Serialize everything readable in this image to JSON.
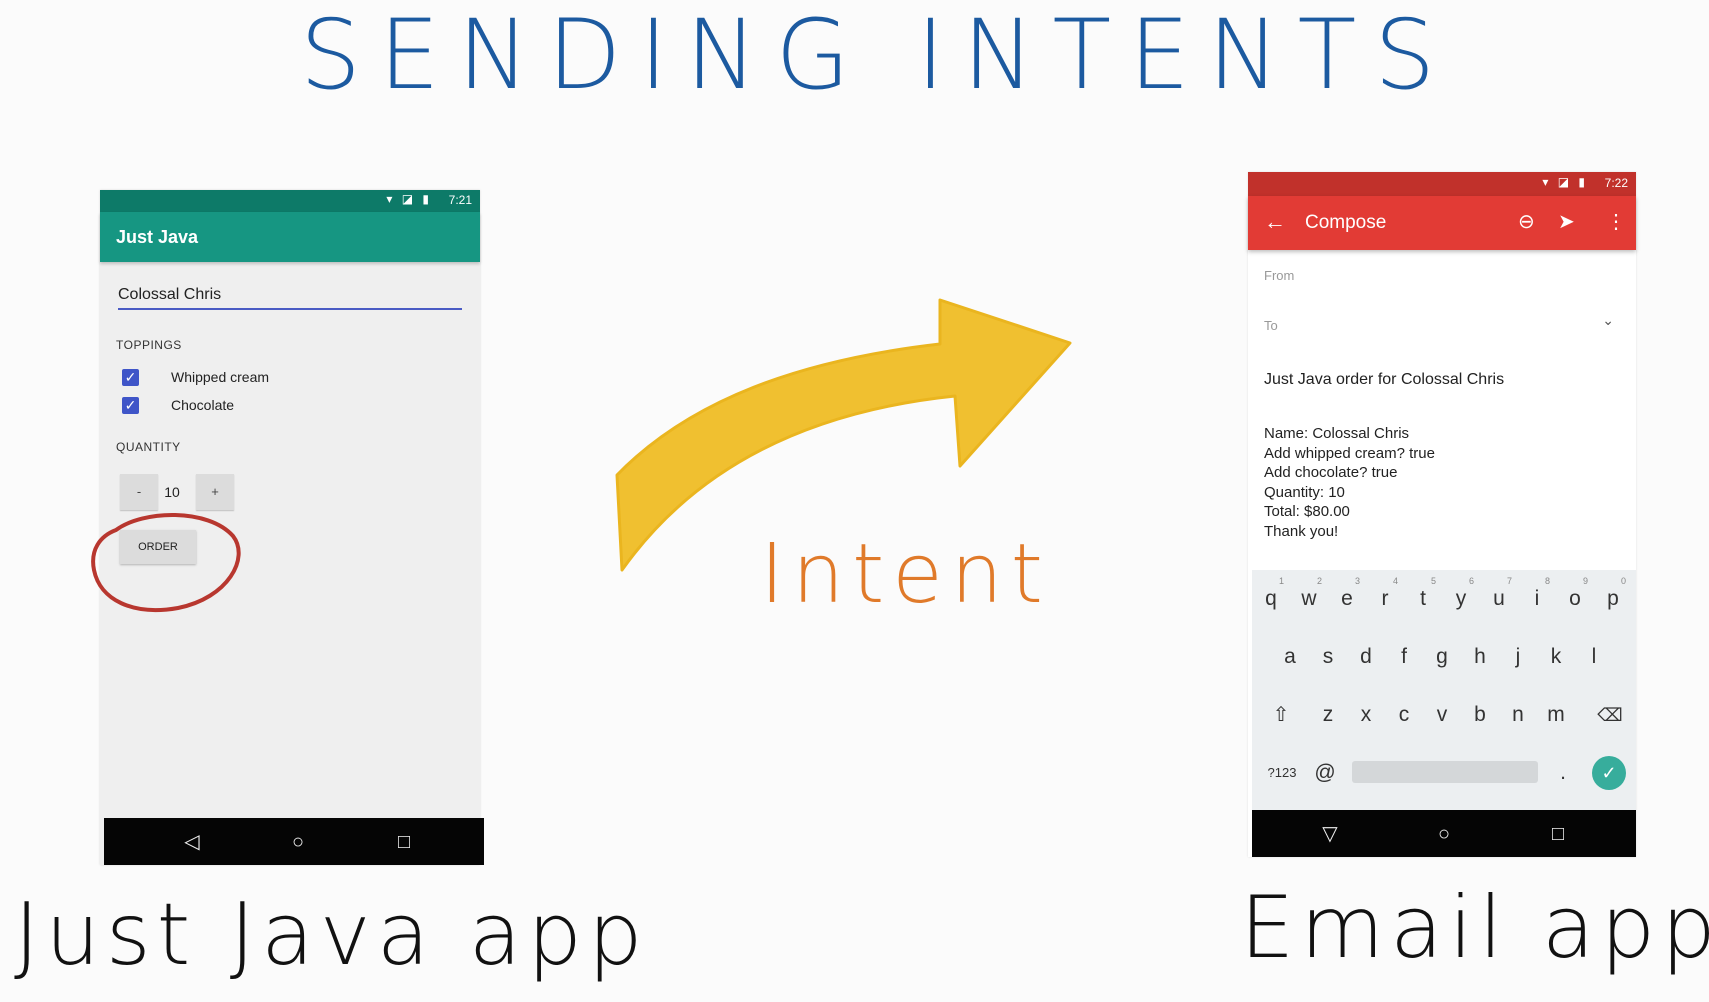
{
  "slide": {
    "title": "SENDING  INTENTS",
    "intent_label": "Intent",
    "left_caption": "Just Java app",
    "right_caption": "Email app",
    "colors": {
      "title": "#1c5aa0",
      "arrow": "#f0c030",
      "intent_label": "#e07a2a",
      "circle": "#b8372f"
    }
  },
  "just_java": {
    "status_time": "7:21",
    "app_title": "Just Java",
    "name_value": "Colossal Chris",
    "toppings_label": "TOPPINGS",
    "toppings": [
      {
        "label": "Whipped cream",
        "checked": true
      },
      {
        "label": "Chocolate",
        "checked": true
      }
    ],
    "quantity_label": "QUANTITY",
    "decrement_label": "-",
    "quantity_value": "10",
    "increment_label": "+",
    "order_label": "ORDER",
    "colors": {
      "status": "#0d7a68",
      "appbar": "#169682",
      "checkbox": "#3f55c8"
    }
  },
  "email": {
    "status_time": "7:22",
    "toolbar_title": "Compose",
    "icons": [
      "back-arrow-icon",
      "attach-icon",
      "send-icon",
      "more-vert-icon"
    ],
    "from_label": "From",
    "to_label": "To",
    "subject": "Just Java order for Colossal Chris",
    "body_lines": [
      "Name: Colossal Chris",
      "Add whipped cream? true",
      "Add chocolate? true",
      "Quantity: 10",
      "Total: $80.00",
      "Thank you!"
    ],
    "keyboard": {
      "row1": [
        "q",
        "w",
        "e",
        "r",
        "t",
        "y",
        "u",
        "i",
        "o",
        "p"
      ],
      "row1_hints": [
        "1",
        "2",
        "3",
        "4",
        "5",
        "6",
        "7",
        "8",
        "9",
        "0"
      ],
      "row2": [
        "a",
        "s",
        "d",
        "f",
        "g",
        "h",
        "j",
        "k",
        "l"
      ],
      "row3": [
        "z",
        "x",
        "c",
        "v",
        "b",
        "n",
        "m"
      ],
      "symbols_key": "?123",
      "at_key": "@",
      "period_key": "."
    },
    "colors": {
      "status": "#c1312b",
      "appbar": "#e23b35",
      "enter": "#37ad9c"
    }
  }
}
